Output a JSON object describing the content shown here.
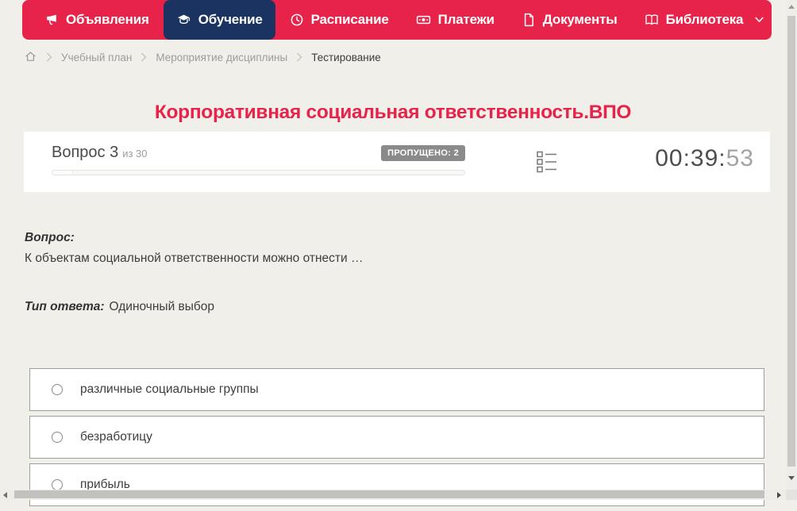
{
  "nav": {
    "items": [
      {
        "label": "Объявления",
        "icon": "megaphone-icon",
        "active": false
      },
      {
        "label": "Обучение",
        "icon": "graduation-cap-icon",
        "active": true
      },
      {
        "label": "Расписание",
        "icon": "clock-icon",
        "active": false
      },
      {
        "label": "Платежи",
        "icon": "banknote-icon",
        "active": false
      },
      {
        "label": "Документы",
        "icon": "document-icon",
        "active": false
      },
      {
        "label": "Библиотека",
        "icon": "book-icon",
        "active": false,
        "has_dropdown": true
      }
    ]
  },
  "breadcrumb": {
    "items": [
      {
        "label": "Учебный план"
      },
      {
        "label": "Мероприятие дисциплины"
      },
      {
        "label": "Тестирование"
      }
    ]
  },
  "page": {
    "title": "Корпоративная социальная ответственность.ВПО"
  },
  "quiz": {
    "question_number_label": "Вопрос 3",
    "question_of_label": "из 30",
    "skipped_badge": "ПРОПУЩЕНО: 2",
    "progress_percent": 5,
    "timer_main": "00:39:",
    "timer_seconds": "53"
  },
  "question": {
    "label": "Вопрос:",
    "text": "К объектам социальной ответственности можно отнести …",
    "answer_type_label": "Тип ответа:",
    "answer_type_value": "Одиночный выбор"
  },
  "answers": [
    {
      "label": "различные социальные группы",
      "selected": false
    },
    {
      "label": "безработицу",
      "selected": false
    },
    {
      "label": "прибыль",
      "selected": false
    }
  ],
  "colors": {
    "accent_red": "#e7234a",
    "active_navy": "#1a3360",
    "page_bg": "#f1efe9",
    "badge_gray": "#8a8a8a"
  }
}
